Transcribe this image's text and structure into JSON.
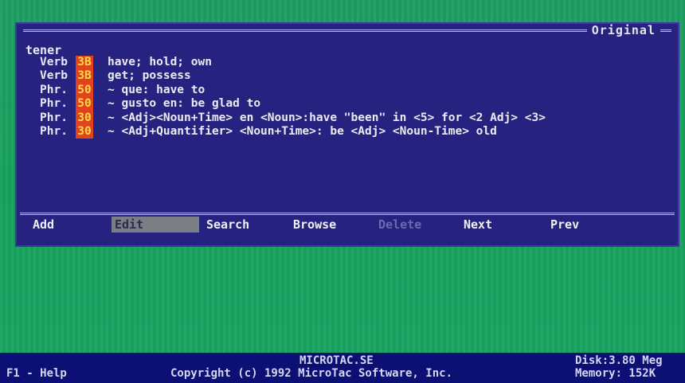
{
  "window": {
    "title": "Original",
    "headword": "tener",
    "entries": [
      {
        "pos": "Verb",
        "freq": "3B",
        "definition": "have; hold; own"
      },
      {
        "pos": "Verb",
        "freq": "3B",
        "definition": "get; possess"
      },
      {
        "pos": "Phr.",
        "freq": "50",
        "definition": "~ que: have to"
      },
      {
        "pos": "Phr.",
        "freq": "50",
        "definition": "~ gusto en: be glad to"
      },
      {
        "pos": "Phr.",
        "freq": "30",
        "definition": "~ <Adj><Noun+Time> en <Noun>:have \"been\" in <5> for <2 Adj> <3>"
      },
      {
        "pos": "Phr.",
        "freq": "30",
        "definition": "~ <Adj+Quantifier> <Noun+Time>: be <Adj> <Noun-Time> old"
      }
    ]
  },
  "menu": {
    "add": "Add",
    "edit": "Edit",
    "search": "Search",
    "browse": "Browse",
    "delete": "Delete",
    "next": "Next",
    "prev": "Prev"
  },
  "status": {
    "help": "F1 - Help",
    "filename": "MICROTAC.SE",
    "copyright": "Copyright (c) 1992 MicroTac Software, Inc.",
    "disk": "Disk:3.80 Meg",
    "memory": "Memory: 152K"
  },
  "colors": {
    "desktop": "#1fa35f",
    "window": "#25237f",
    "status_bar": "#0c0f74",
    "freq_badge": "#e2421c",
    "freq_text": "#ffd94a",
    "selected_menu": "#7a7f86"
  }
}
